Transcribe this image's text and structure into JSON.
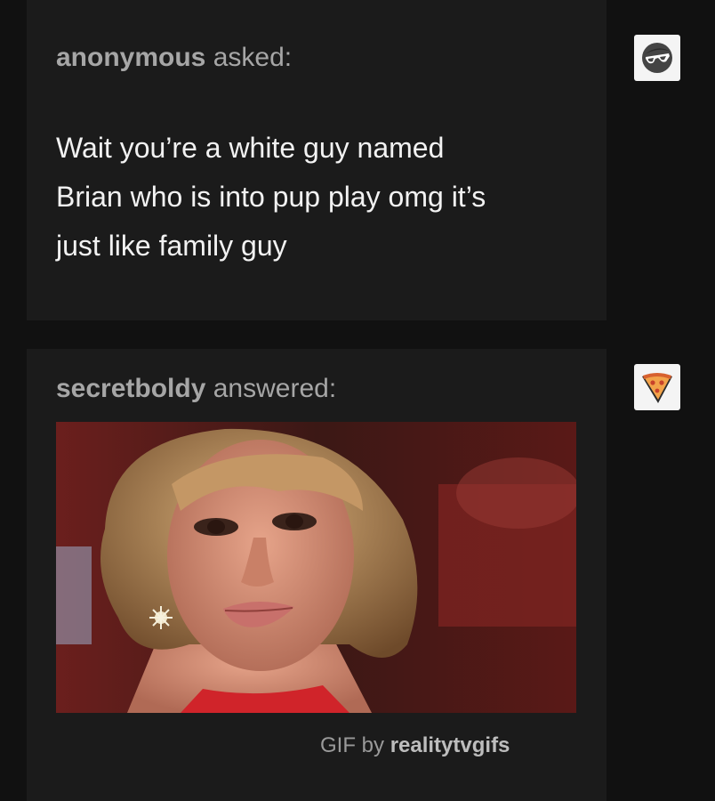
{
  "ask": {
    "username": "anonymous",
    "verb": "asked:",
    "avatar_icon": "anonymous-sunglasses-icon",
    "question_lines": [
      "Wait you’re a white guy named",
      "Brian who is into pup play omg it’s",
      "just like family guy"
    ]
  },
  "answer": {
    "username": "secretboldy",
    "verb": "answered:",
    "avatar_icon": "pizza-slice-icon",
    "gif_credit_prefix": "GIF by",
    "gif_credit_user": "realitytvgifs"
  },
  "colors": {
    "background": "#111111",
    "panel": "#1b1b1b",
    "question_text": "#f2f2f2",
    "attribution_text": "#a6a6a6"
  }
}
